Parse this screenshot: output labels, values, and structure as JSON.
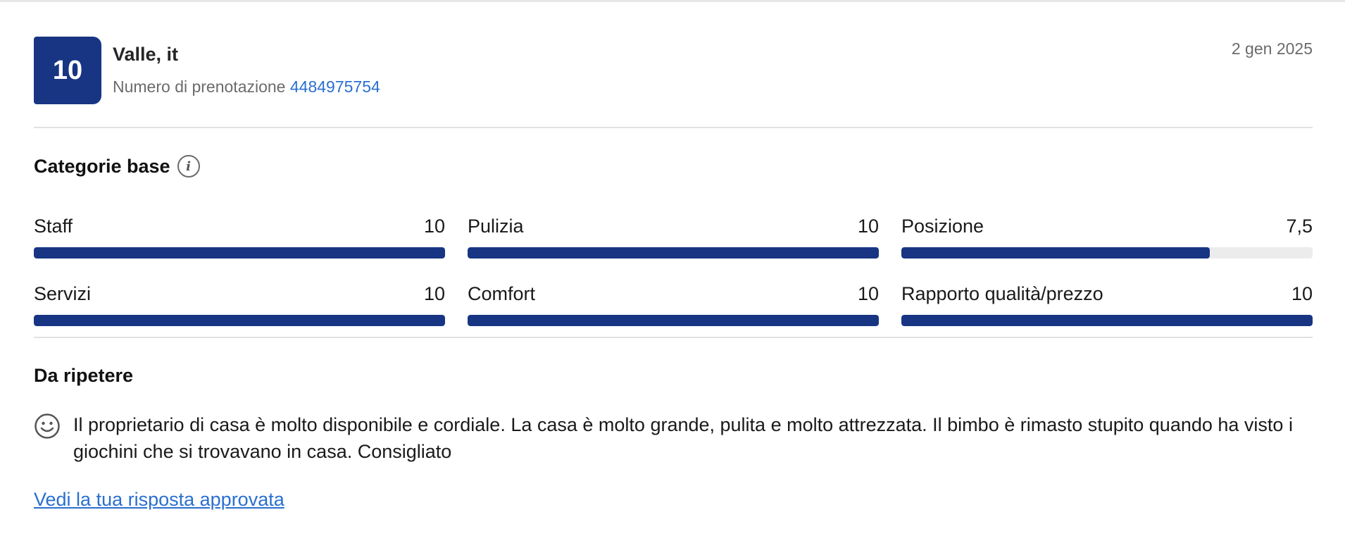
{
  "review": {
    "score": "10",
    "guest_name": "Valle, it",
    "booking_label": "Numero di prenotazione",
    "booking_number": "4484975754",
    "date": "2 gen 2025"
  },
  "categories": {
    "title": "Categorie base",
    "items": [
      {
        "label": "Staff",
        "value": "10",
        "fraction": 1.0
      },
      {
        "label": "Pulizia",
        "value": "10",
        "fraction": 1.0
      },
      {
        "label": "Posizione",
        "value": "7,5",
        "fraction": 0.75
      },
      {
        "label": "Servizi",
        "value": "10",
        "fraction": 1.0
      },
      {
        "label": "Comfort",
        "value": "10",
        "fraction": 1.0
      },
      {
        "label": "Rapporto qualità/prezzo",
        "value": "10",
        "fraction": 1.0
      }
    ]
  },
  "liked": {
    "title": "Da ripetere",
    "text": "Il proprietario di casa è molto disponibile e cordiale. La casa è molto grande, pulita e molto attrezzata. Il bimbo è rimasto stupito quando ha visto i giochini che si trovavano in casa. Consigliato"
  },
  "approved_response_link": "Vedi la tua risposta approvata",
  "icons": {
    "info": "info-icon",
    "smile": "smile-icon"
  },
  "colors": {
    "brand": "#173583",
    "link": "#2a6fcf",
    "muted": "#6b6b6b",
    "track": "#ececec"
  }
}
